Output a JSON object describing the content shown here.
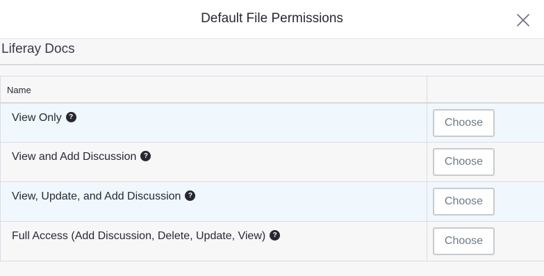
{
  "modal": {
    "title": "Default File Permissions",
    "close_icon": "close-icon"
  },
  "section": {
    "title": "Liferay Docs"
  },
  "table": {
    "columns": [
      "Name",
      ""
    ],
    "rows": [
      {
        "label": "View Only",
        "help_icon": "question-icon",
        "action": "Choose"
      },
      {
        "label": "View and Add Discussion",
        "help_icon": "question-icon",
        "action": "Choose"
      },
      {
        "label": "View, Update, and Add Discussion",
        "help_icon": "question-icon",
        "action": "Choose"
      },
      {
        "label": "Full Access (Add Discussion, Delete, Update, View)",
        "help_icon": "question-icon",
        "action": "Choose"
      }
    ]
  },
  "colors": {
    "highlight_row": "#f0f8fe",
    "button_text": "#6b7a89",
    "button_border": "#c7cacf"
  }
}
